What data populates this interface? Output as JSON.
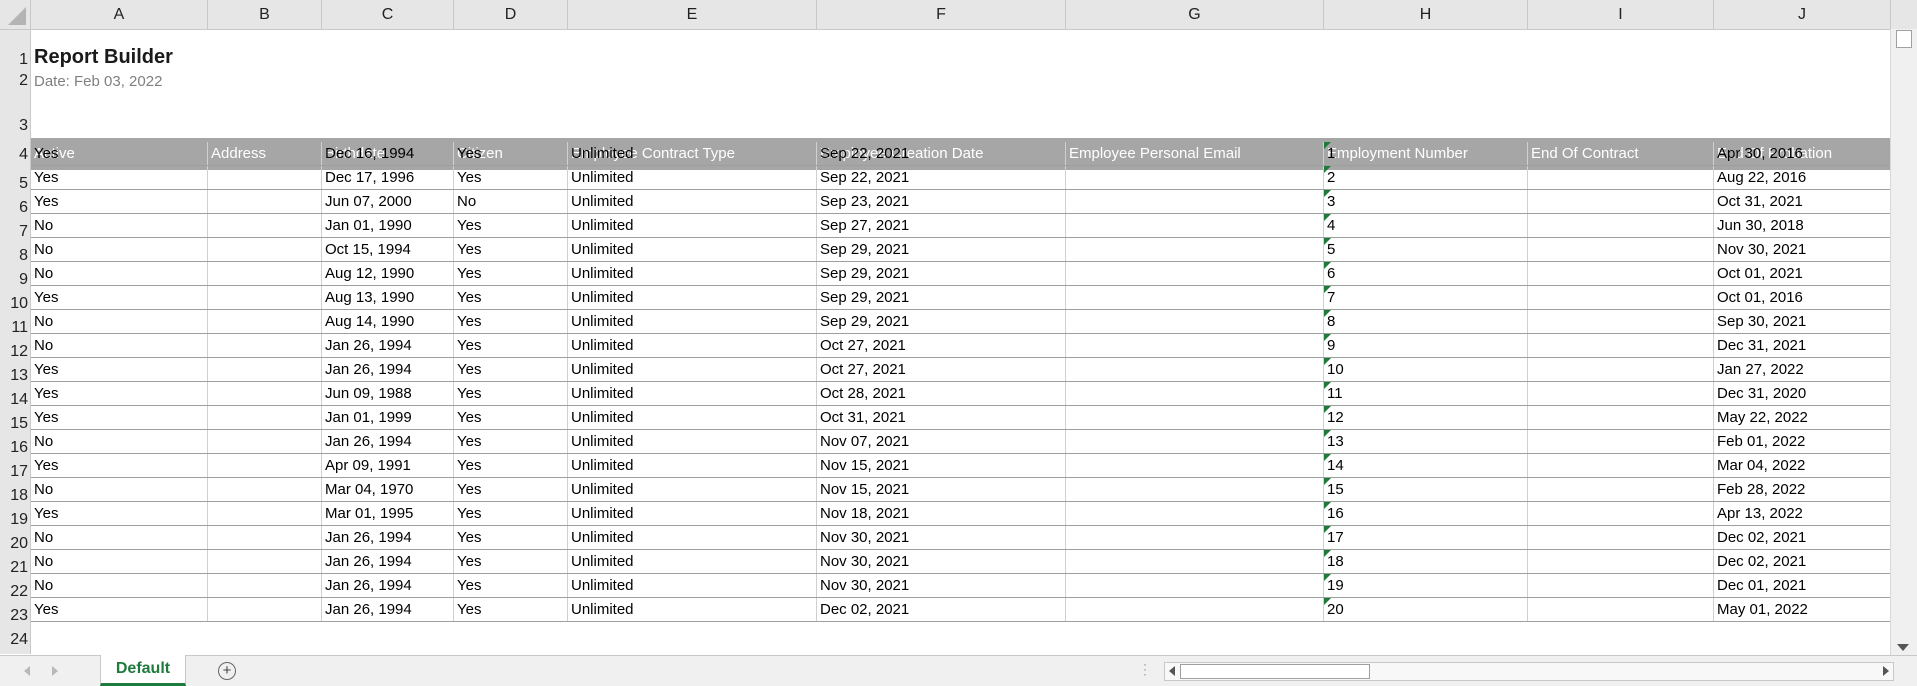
{
  "sheet": {
    "columns": [
      "A",
      "B",
      "C",
      "D",
      "E",
      "F",
      "G",
      "H",
      "I",
      "J"
    ],
    "row_numbers": [
      "1",
      "2",
      "3",
      "4",
      "5",
      "6",
      "7",
      "8",
      "9",
      "10",
      "11",
      "12",
      "13",
      "14",
      "15",
      "16",
      "17",
      "18",
      "19",
      "20",
      "21",
      "22",
      "23",
      "24"
    ],
    "title": "Report Builder",
    "subtitle": "Date: Feb 03, 2022",
    "headers": [
      "Active",
      "Address",
      "Birthdate",
      "Citizen",
      "Employee Contract Type",
      "Employee Creation Date",
      "Employee Personal Email",
      "Employment Number",
      "End Of Contract",
      "End Of Probation"
    ],
    "rows": [
      [
        "Yes",
        "",
        "Dec 16, 1994",
        "Yes",
        "Unlimited",
        "Sep 22, 2021",
        "",
        "1",
        "",
        "Apr 30, 2016"
      ],
      [
        "Yes",
        "",
        "Dec 17, 1996",
        "Yes",
        "Unlimited",
        "Sep 22, 2021",
        "",
        "2",
        "",
        "Aug 22, 2016"
      ],
      [
        "Yes",
        "",
        "Jun 07, 2000",
        "No",
        "Unlimited",
        "Sep 23, 2021",
        "",
        "3",
        "",
        "Oct 31, 2021"
      ],
      [
        "No",
        "",
        "Jan 01, 1990",
        "Yes",
        "Unlimited",
        "Sep 27, 2021",
        "",
        "4",
        "",
        "Jun 30, 2018"
      ],
      [
        "No",
        "",
        "Oct 15, 1994",
        "Yes",
        "Unlimited",
        "Sep 29, 2021",
        "",
        "5",
        "",
        "Nov 30, 2021"
      ],
      [
        "No",
        "",
        "Aug 12, 1990",
        "Yes",
        "Unlimited",
        "Sep 29, 2021",
        "",
        "6",
        "",
        "Oct 01, 2021"
      ],
      [
        "Yes",
        "",
        "Aug 13, 1990",
        "Yes",
        "Unlimited",
        "Sep 29, 2021",
        "",
        "7",
        "",
        "Oct 01, 2016"
      ],
      [
        "No",
        "",
        "Aug 14, 1990",
        "Yes",
        "Unlimited",
        "Sep 29, 2021",
        "",
        "8",
        "",
        "Sep 30, 2021"
      ],
      [
        "No",
        "",
        "Jan 26, 1994",
        "Yes",
        "Unlimited",
        "Oct 27, 2021",
        "",
        "9",
        "",
        "Dec 31, 2021"
      ],
      [
        "Yes",
        "",
        "Jan 26, 1994",
        "Yes",
        "Unlimited",
        "Oct 27, 2021",
        "",
        "10",
        "",
        "Jan 27, 2022"
      ],
      [
        "Yes",
        "",
        "Jun 09, 1988",
        "Yes",
        "Unlimited",
        "Oct 28, 2021",
        "",
        "11",
        "",
        "Dec 31, 2020"
      ],
      [
        "Yes",
        "",
        "Jan 01, 1999",
        "Yes",
        "Unlimited",
        "Oct 31, 2021",
        "",
        "12",
        "",
        "May 22, 2022"
      ],
      [
        "No",
        "",
        "Jan 26, 1994",
        "Yes",
        "Unlimited",
        "Nov 07, 2021",
        "",
        "13",
        "",
        "Feb 01, 2022"
      ],
      [
        "Yes",
        "",
        "Apr 09, 1991",
        "Yes",
        "Unlimited",
        "Nov 15, 2021",
        "",
        "14",
        "",
        "Mar 04, 2022"
      ],
      [
        "No",
        "",
        "Mar 04, 1970",
        "Yes",
        "Unlimited",
        "Nov 15, 2021",
        "",
        "15",
        "",
        "Feb 28, 2022"
      ],
      [
        "Yes",
        "",
        "Mar 01, 1995",
        "Yes",
        "Unlimited",
        "Nov 18, 2021",
        "",
        "16",
        "",
        "Apr 13, 2022"
      ],
      [
        "No",
        "",
        "Jan 26, 1994",
        "Yes",
        "Unlimited",
        "Nov 30, 2021",
        "",
        "17",
        "",
        "Dec 02, 2021"
      ],
      [
        "No",
        "",
        "Jan 26, 1994",
        "Yes",
        "Unlimited",
        "Nov 30, 2021",
        "",
        "18",
        "",
        "Dec 02, 2021"
      ],
      [
        "No",
        "",
        "Jan 26, 1994",
        "Yes",
        "Unlimited",
        "Nov 30, 2021",
        "",
        "19",
        "",
        "Dec 01, 2021"
      ],
      [
        "Yes",
        "",
        "Jan 26, 1994",
        "Yes",
        "Unlimited",
        "Dec 02, 2021",
        "",
        "20",
        "",
        "May 01, 2022"
      ]
    ]
  },
  "tabs": {
    "active": "Default",
    "add_icon": "plus-circle-icon"
  },
  "colors": {
    "header_band": "#a6a6a6",
    "accent_green": "#1f7a3e"
  }
}
